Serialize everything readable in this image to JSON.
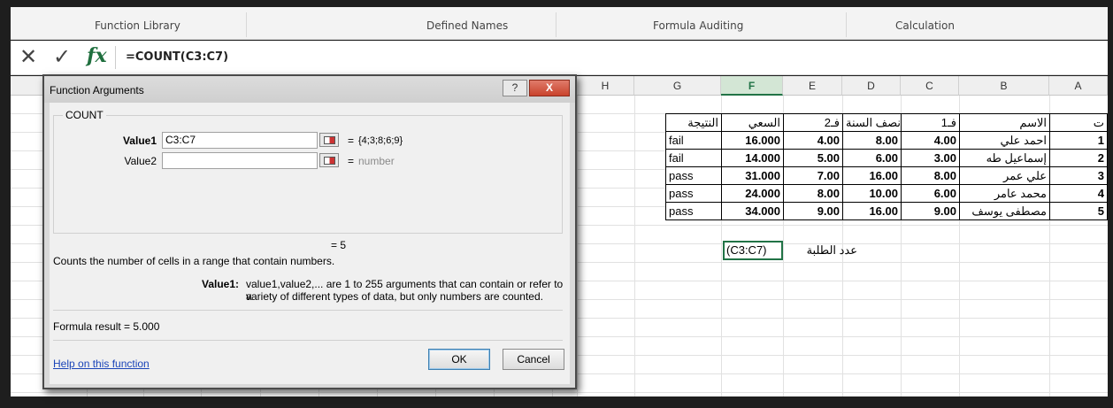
{
  "ribbon": {
    "groups": [
      "Function Library",
      "Defined Names",
      "Formula Auditing",
      "Calculation"
    ]
  },
  "formula_bar": {
    "cancel_icon": "close-icon",
    "enter_icon": "check-icon",
    "fx_label": "fx",
    "formula": "=COUNT(C3:C7)"
  },
  "sheet": {
    "columns": [
      "H",
      "G",
      "F",
      "E",
      "D",
      "C",
      "B",
      "A"
    ],
    "selected_column": "F",
    "header_row": [
      "النتيجة",
      "السعي",
      "فـ2",
      "نصف السنة",
      "فـ1",
      "الاسم",
      "ت"
    ],
    "rows": [
      [
        "fail",
        "16.000",
        "4.00",
        "8.00",
        "4.00",
        "احمد علي",
        "1"
      ],
      [
        "fail",
        "14.000",
        "5.00",
        "6.00",
        "3.00",
        "إسماعيل طه",
        "2"
      ],
      [
        "pass",
        "31.000",
        "7.00",
        "16.00",
        "8.00",
        "علي عمر",
        "3"
      ],
      [
        "pass",
        "24.000",
        "8.00",
        "10.00",
        "6.00",
        "محمد عامر",
        "4"
      ],
      [
        "pass",
        "34.000",
        "9.00",
        "16.00",
        "9.00",
        "مصطفى يوسف",
        "5"
      ]
    ],
    "active_cell_text": "(C3:C7)",
    "count_label": "عدد الطلبة"
  },
  "dialog": {
    "title": "Function Arguments",
    "help_button": "?",
    "close_button": "X",
    "function_name": "COUNT",
    "args": [
      {
        "label": "Value1",
        "value": "C3:C7",
        "result": "{4;3;8;6;9}"
      },
      {
        "label": "Value2",
        "value": "",
        "result": "number"
      }
    ],
    "equals": "=",
    "result_line": "= 5",
    "description": "Counts the number of cells in a range that contain numbers.",
    "arg_desc_label": "Value1:",
    "arg_desc_line1": "value1,value2,... are 1 to 255 arguments that can contain or refer to a",
    "arg_desc_line2": "variety of different types of data, but only numbers are counted.",
    "formula_result": "Formula result =   5.000",
    "help_link": "Help on this function",
    "ok_label": "OK",
    "cancel_label": "Cancel"
  }
}
